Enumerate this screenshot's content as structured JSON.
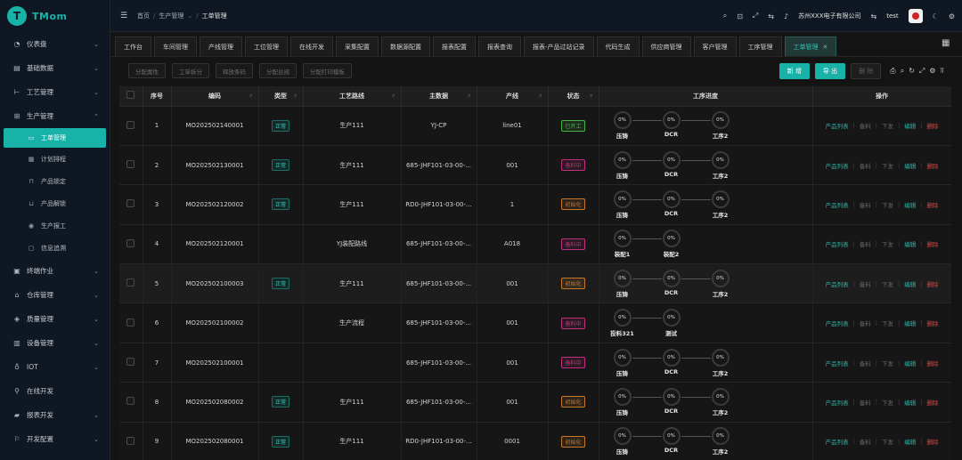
{
  "app": {
    "logo_badge": "T",
    "logo_text": "TMom"
  },
  "sidebar": {
    "items": [
      {
        "label": "仪表盘",
        "icon": "dashboard-icon",
        "chevron": "⌄"
      },
      {
        "label": "基础数据",
        "icon": "database-icon",
        "chevron": "⌄"
      },
      {
        "label": "工艺管理",
        "icon": "process-icon",
        "chevron": "⌄"
      },
      {
        "label": "生产管理",
        "icon": "production-icon",
        "chevron": "⌃"
      }
    ],
    "sub_items": [
      {
        "label": "工单管理",
        "icon": "order-icon",
        "active": true
      },
      {
        "label": "计划排程",
        "icon": "schedule-icon"
      },
      {
        "label": "产品锁定",
        "icon": "lock-icon"
      },
      {
        "label": "产品解锁",
        "icon": "unlock-icon"
      },
      {
        "label": "生产报工",
        "icon": "report-icon"
      },
      {
        "label": "信息追溯",
        "icon": "trace-icon"
      }
    ],
    "items_after": [
      {
        "label": "终端作业",
        "icon": "terminal-icon",
        "chevron": "⌄"
      },
      {
        "label": "仓库管理",
        "icon": "warehouse-icon",
        "chevron": "⌄"
      },
      {
        "label": "质量管理",
        "icon": "quality-icon",
        "chevron": "⌄"
      },
      {
        "label": "设备管理",
        "icon": "device-icon",
        "chevron": "⌄"
      },
      {
        "label": "IOT",
        "icon": "iot-icon",
        "chevron": "⌄"
      },
      {
        "label": "在线开发",
        "icon": "code-icon",
        "chevron": ""
      },
      {
        "label": "报表开发",
        "icon": "chart-icon",
        "chevron": "⌄"
      },
      {
        "label": "开发配置",
        "icon": "config-icon",
        "chevron": "⌄"
      }
    ]
  },
  "header": {
    "breadcrumbs": [
      "首页",
      "生产管理",
      "工单管理"
    ],
    "company": "苏州XXX电子有限公司",
    "user": "test"
  },
  "tabs": [
    "工作台",
    "车间管理",
    "产线管理",
    "工位管理",
    "在线开发",
    "采集配置",
    "数据源配置",
    "报表配置",
    "报表查询",
    "报表-产品过站记录",
    "代码生成",
    "供应商管理",
    "客户管理",
    "工序管理",
    "工单管理"
  ],
  "toolbar": {
    "left_buttons": [
      "分配属性",
      "工单拆分",
      "释放条码",
      "分配台阅",
      "分配打印模板"
    ],
    "new_label": "新 增",
    "export_label": "导 出",
    "delete_label": "删 除"
  },
  "table": {
    "headers": [
      "序号",
      "编码",
      "类型",
      "工艺路线",
      "主数据",
      "产线",
      "状态",
      "工序进度",
      "操作"
    ],
    "rows": [
      {
        "no": "1",
        "code": "MO202502140001",
        "type": "正常",
        "route": "生产111",
        "master": "YJ-CP",
        "line": "line01",
        "status": "已开工",
        "status_color": "#49b34a",
        "steps": [
          {
            "pct": "0%",
            "name": "压铸"
          },
          {
            "pct": "0%",
            "name": "DCR"
          },
          {
            "pct": "0%",
            "name": "工序2"
          }
        ]
      },
      {
        "no": "2",
        "code": "MO202502130001",
        "type": "正常",
        "route": "生产111",
        "master": "685-JHF101-03-00-...",
        "line": "001",
        "status": "备料中",
        "status_color": "#c0307e",
        "steps": [
          {
            "pct": "0%",
            "name": "压铸"
          },
          {
            "pct": "0%",
            "name": "DCR"
          },
          {
            "pct": "0%",
            "name": "工序2"
          }
        ]
      },
      {
        "no": "3",
        "code": "MO202502120002",
        "type": "正常",
        "route": "生产111",
        "master": "RD0-JHF101-03-00-...",
        "line": "1",
        "status": "初始化",
        "status_color": "#c7782c",
        "steps": [
          {
            "pct": "0%",
            "name": "压铸"
          },
          {
            "pct": "0%",
            "name": "DCR"
          },
          {
            "pct": "0%",
            "name": "工序2"
          }
        ]
      },
      {
        "no": "4",
        "code": "MO202502120001",
        "type": "",
        "route": "YJ装配路线",
        "master": "685-JHF101-03-00-...",
        "line": "A018",
        "status": "备料中",
        "status_color": "#c0307e",
        "steps": [
          {
            "pct": "0%",
            "name": "装配1"
          },
          {
            "pct": "0%",
            "name": "装配2"
          }
        ]
      },
      {
        "no": "5",
        "code": "MO202502100003",
        "type": "正常",
        "route": "生产111",
        "master": "685-JHF101-03-00-...",
        "line": "001",
        "status": "初始化",
        "status_color": "#c7782c",
        "steps": [
          {
            "pct": "0%",
            "name": "压铸"
          },
          {
            "pct": "0%",
            "name": "DCR"
          },
          {
            "pct": "0%",
            "name": "工序2"
          }
        ]
      },
      {
        "no": "6",
        "code": "MO202502100002",
        "type": "",
        "route": "生产流程",
        "master": "685-JHF101-03-00-...",
        "line": "001",
        "status": "备料中",
        "status_color": "#c0307e",
        "steps": [
          {
            "pct": "0%",
            "name": "投料321"
          },
          {
            "pct": "0%",
            "name": "测试"
          }
        ]
      },
      {
        "no": "7",
        "code": "MO202502100001",
        "type": "",
        "route": "",
        "master": "685-JHF101-03-00-...",
        "line": "001",
        "status": "备料中",
        "status_color": "#c0307e",
        "steps": [
          {
            "pct": "0%",
            "name": "压铸"
          },
          {
            "pct": "0%",
            "name": "DCR"
          },
          {
            "pct": "0%",
            "name": "工序2"
          }
        ]
      },
      {
        "no": "8",
        "code": "MO202502080002",
        "type": "正常",
        "route": "生产111",
        "master": "685-JHF101-03-00-...",
        "line": "001",
        "status": "初始化",
        "status_color": "#c7782c",
        "steps": [
          {
            "pct": "0%",
            "name": "压铸"
          },
          {
            "pct": "0%",
            "name": "DCR"
          },
          {
            "pct": "0%",
            "name": "工序2"
          }
        ]
      },
      {
        "no": "9",
        "code": "MO202502080001",
        "type": "正常",
        "route": "生产111",
        "master": "RD0-JHF101-03-00-...",
        "line": "0001",
        "status": "初始化",
        "status_color": "#c7782c",
        "steps": [
          {
            "pct": "0%",
            "name": "压铸"
          },
          {
            "pct": "0%",
            "name": "DCR"
          },
          {
            "pct": "0%",
            "name": "工序2"
          }
        ]
      }
    ],
    "ops": [
      "产品列表",
      "备料",
      "下发",
      "编辑",
      "删除"
    ]
  },
  "colors": {
    "accent": "#18b2a8",
    "danger": "#d94848"
  }
}
